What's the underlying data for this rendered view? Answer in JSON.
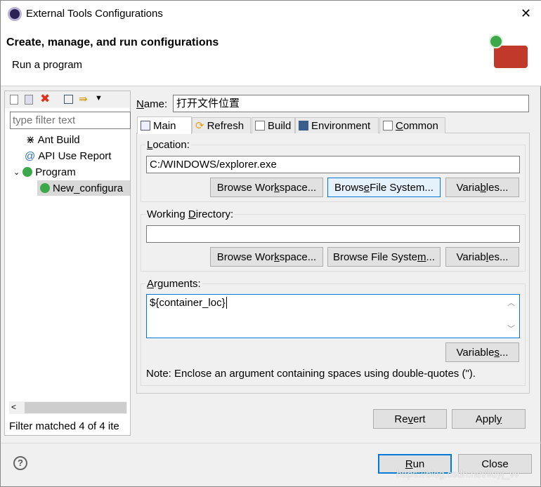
{
  "window": {
    "title": "External Tools Configurations",
    "close": "✕"
  },
  "header": {
    "title": "Create, manage, and run configurations",
    "subtitle": "Run a program"
  },
  "sidebar": {
    "filter_placeholder": "type filter text",
    "items": [
      {
        "label": "Ant Build",
        "icon": "ant-icon"
      },
      {
        "label": "API Use Report",
        "icon": "api-report-icon"
      },
      {
        "label": "Program",
        "icon": "program-icon",
        "expanded": true
      },
      {
        "label": "New_configura",
        "icon": "program-icon",
        "selected": true
      }
    ],
    "status": "Filter matched 4 of 4 ite"
  },
  "form": {
    "name_label": "Name:",
    "name_value": "打开文件位置",
    "tabs": [
      {
        "label": "Main",
        "active": true
      },
      {
        "label": "Refresh"
      },
      {
        "label": "Build"
      },
      {
        "label": "Environment"
      },
      {
        "label": "Common"
      }
    ],
    "location": {
      "label": "Location:",
      "value": "C:/WINDOWS/explorer.exe",
      "browse_workspace": "Browse Workspace...",
      "browse_fs": "Browse File System...",
      "variables": "Variables..."
    },
    "working_dir": {
      "label": "Working Directory:",
      "value": "",
      "browse_workspace": "Browse Workspace...",
      "browse_fs": "Browse File System...",
      "variables": "Variables..."
    },
    "arguments": {
      "label": "Arguments:",
      "value": "${container_loc}",
      "variables": "Variables...",
      "note": "Note: Enclose an argument containing spaces using double-quotes (\")."
    },
    "revert": "Revert",
    "apply": "Apply"
  },
  "footer": {
    "run": "Run",
    "close": "Close",
    "help": "?"
  },
  "watermark": "https://blog.csdn.net/liuyj_vv",
  "colors": {
    "accent": "#0078d7",
    "selection": "#d9d9d9"
  }
}
